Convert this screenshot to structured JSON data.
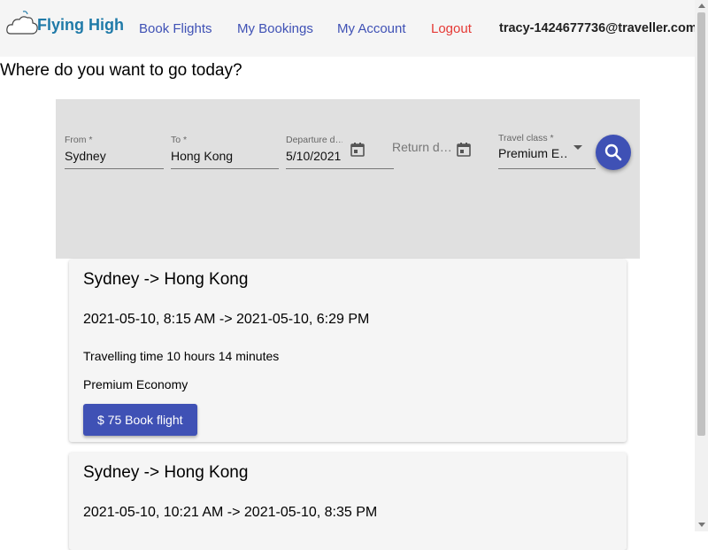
{
  "header": {
    "logo_text": "Flying High",
    "nav": [
      "Book Flights",
      "My Bookings",
      "My Account",
      "Logout"
    ],
    "user_email": "tracy-1424677736@traveller.com"
  },
  "page_title": "Where do you want to go today?",
  "search": {
    "from_label": "From *",
    "from_value": "Sydney",
    "to_label": "To *",
    "to_value": "Hong Kong",
    "departure_label": "Departure d…",
    "departure_value": "5/10/2021",
    "return_placeholder": "Return d…",
    "class_label": "Travel class *",
    "class_value": "Premium E…"
  },
  "results": [
    {
      "route": "Sydney -> Hong Kong",
      "times": "2021-05-10, 8:15 AM -> 2021-05-10, 6:29 PM",
      "duration": "Travelling time 10 hours 14 minutes",
      "travel_class": "Premium Economy",
      "book_label": "$ 75 Book flight"
    },
    {
      "route": "Sydney -> Hong Kong",
      "times": "2021-05-10, 10:21 AM -> 2021-05-10, 8:35 PM"
    }
  ],
  "icons": {
    "logo": "cloud-icon",
    "calendar": "calendar-icon",
    "dropdown": "dropdown-arrow-icon",
    "search": "search-icon"
  },
  "colors": {
    "primary": "#3f51b5",
    "logout": "#e53935",
    "header_bg": "#f5f5f5",
    "panel_bg": "#e0e0e0"
  }
}
